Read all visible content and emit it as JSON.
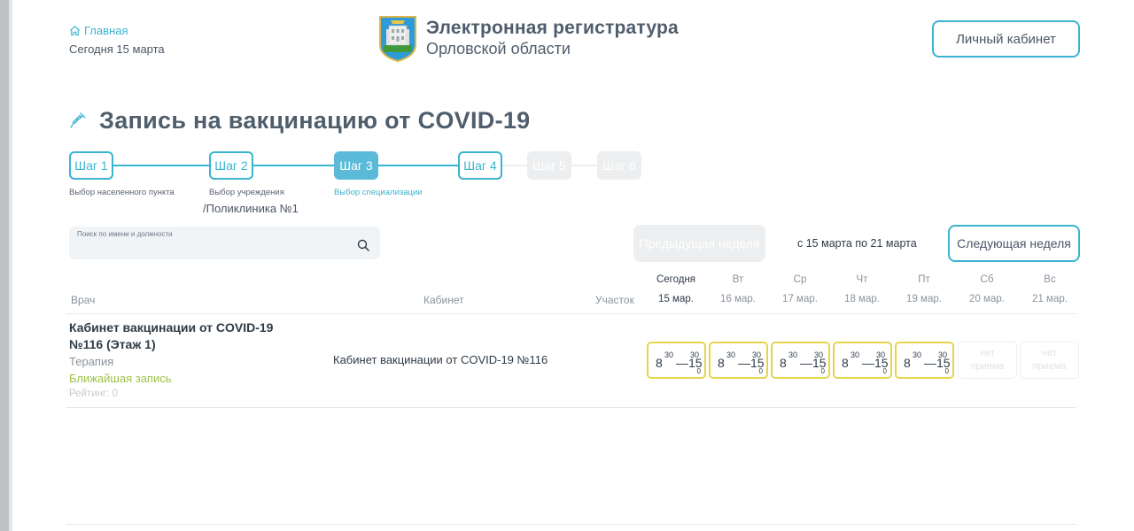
{
  "header": {
    "home_label": "Главная",
    "today_label": "Сегодня 15 марта",
    "brand_title": "Электронная регистратура",
    "brand_subtitle": "Орловской области",
    "cabinet_button": "Личный кабинет"
  },
  "page": {
    "title": "Запись на вакцинацию от COVID-19"
  },
  "stepper": {
    "steps": [
      {
        "label": "Шаг 1",
        "state": "done",
        "caption": "Выбор населенного пункта"
      },
      {
        "label": "Шаг 2",
        "state": "done",
        "caption": "Выбор учреждения",
        "value": "/Поликлиника №1"
      },
      {
        "label": "Шаг 3",
        "state": "active",
        "caption": "Выбор специализации"
      },
      {
        "label": "Шаг 4",
        "state": "pending"
      },
      {
        "label": "Шаг 5",
        "state": "disabled"
      },
      {
        "label": "Шаг 6",
        "state": "disabled"
      }
    ]
  },
  "search": {
    "label": "Поиск по имени и должности",
    "value": ""
  },
  "week_nav": {
    "prev": "Предыдущая неделя",
    "range": "с 15 марта по 21 марта",
    "next": "Следующая неделя"
  },
  "table": {
    "col_doctor": "Врач",
    "col_room": "Кабинет",
    "col_area": "Участок",
    "days": [
      {
        "name": "Сегодня",
        "date": "15 мар."
      },
      {
        "name": "Вт",
        "date": "16 мар."
      },
      {
        "name": "Ср",
        "date": "17 мар."
      },
      {
        "name": "Чт",
        "date": "18 мар."
      },
      {
        "name": "Пт",
        "date": "19 мар."
      },
      {
        "name": "Сб",
        "date": "20 мар."
      },
      {
        "name": "Вс",
        "date": "21 мар."
      }
    ],
    "rows": [
      {
        "name_line1": "Кабинет вакцинации от COVID-19",
        "name_line2": "№116 (Этаж 1)",
        "specialty": "Терапия",
        "nearest": "Ближайшая запись",
        "rating": "Рейтинг: 0",
        "room": "Кабинет вакцинации от COVID-19 №116",
        "slots": [
          {
            "h1": "8",
            "m1": "30",
            "h2": "15",
            "m2": "30",
            "count": "0"
          },
          {
            "h1": "8",
            "m1": "30",
            "h2": "15",
            "m2": "30",
            "count": "0"
          },
          {
            "h1": "8",
            "m1": "30",
            "h2": "15",
            "m2": "30",
            "count": "0"
          },
          {
            "h1": "8",
            "m1": "30",
            "h2": "15",
            "m2": "30",
            "count": "0"
          },
          {
            "h1": "8",
            "m1": "30",
            "h2": "15",
            "m2": "30",
            "count": "0"
          },
          {
            "off_line1": "нет",
            "off_line2": "приема"
          },
          {
            "off_line1": "нет",
            "off_line2": "приема"
          }
        ]
      }
    ]
  },
  "colors": {
    "accent": "#3ab4cf",
    "active_step": "#5bbad8",
    "slot_border": "#e6d54c",
    "nearest": "#9dc24a"
  }
}
